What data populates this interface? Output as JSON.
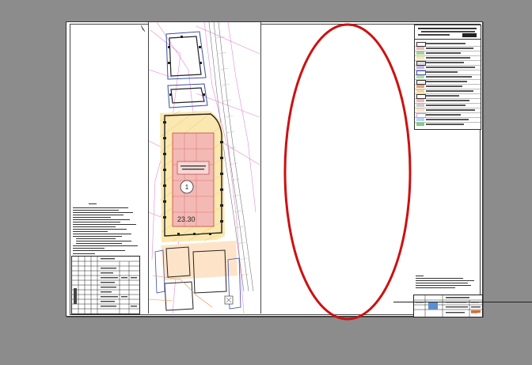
{
  "drawing": {
    "building_number": "1",
    "elevation_label": "23.30",
    "legend_title": "",
    "stamp_text": ""
  },
  "annotation": {
    "ellipse_color": "#cc1111"
  },
  "colors": {
    "page_background": "#8c8c8c",
    "sheet": "#ffffff",
    "building_fill": "#f3b9b5",
    "zone_fill": "#fbe8b0",
    "road_lines": "#e58ad6"
  }
}
